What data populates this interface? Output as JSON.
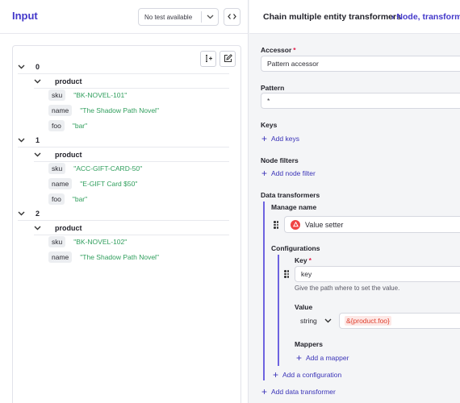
{
  "input_panel": {
    "title": "Input",
    "test_select_value": "No test available",
    "tree": [
      {
        "index": "0",
        "object_key": "product",
        "fields": [
          {
            "key": "sku",
            "value": "\"BK-NOVEL-101\""
          },
          {
            "key": "name",
            "value": "\"The Shadow Path Novel\""
          },
          {
            "key": "foo",
            "value": "\"bar\""
          }
        ]
      },
      {
        "index": "1",
        "object_key": "product",
        "fields": [
          {
            "key": "sku",
            "value": "\"ACC-GIFT-CARD-50\""
          },
          {
            "key": "name",
            "value": "\"E-GIFT Card $50\""
          },
          {
            "key": "foo",
            "value": "\"bar\""
          }
        ]
      },
      {
        "index": "2",
        "object_key": "product",
        "fields": [
          {
            "key": "sku",
            "value": "\"BK-NOVEL-102\""
          },
          {
            "key": "name",
            "value": "\"The Shadow Path Novel\""
          }
        ]
      }
    ]
  },
  "config_panel": {
    "title": "Chain multiple entity transformers",
    "breadcrumb": "› Node, transform",
    "accessor_label": "Accessor",
    "accessor_required": "*",
    "accessor_value": "Pattern accessor",
    "pattern_label": "Pattern",
    "pattern_value": "*",
    "keys_label": "Keys",
    "add_keys": "Add keys",
    "node_filters_label": "Node filters",
    "add_node_filter": "Add node filter",
    "data_transformers_label": "Data transformers",
    "manage_name_label": "Manage name",
    "transformer_value": "Value setter",
    "configurations_label": "Configurations",
    "key_label": "Key",
    "key_required": "*",
    "key_value": "key",
    "key_help": "Give the path where to set the value.",
    "value_label": "Value",
    "value_type": "string",
    "value_expression": "&{product.foo}",
    "mappers_label": "Mappers",
    "add_mapper": "Add a mapper",
    "add_configuration": "Add a configuration",
    "add_data_transformer": "Add data transformer"
  },
  "colors": {
    "accent": "#4338ca",
    "string_value": "#2f9e5c",
    "required": "#e11d48",
    "expression": "#e0412f"
  }
}
